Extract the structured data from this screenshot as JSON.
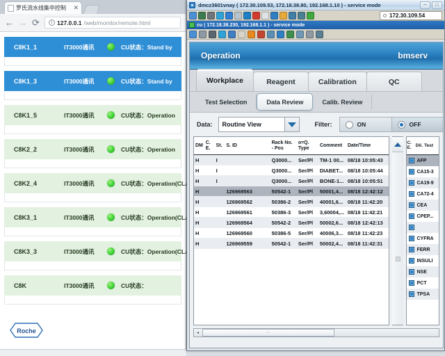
{
  "browser": {
    "tab": {
      "title": "罗氏流水线集中控制",
      "close_label": "✕",
      "favicon": "page-icon"
    },
    "nav": {
      "back": "←",
      "forward": "→",
      "reload": "⟳"
    },
    "omnibox": {
      "info_glyph": "i",
      "host": "127.0.0.1",
      "path": "/web/monitor/remote.html"
    },
    "logo": {
      "text": "Roche"
    }
  },
  "monitor": {
    "rows": [
      {
        "name": "C8K1_1",
        "comm": "IT3000通讯",
        "led": "green",
        "status_label": "CU状态：",
        "status": "Stand by",
        "state": "blue"
      },
      {
        "name": "C8K1_3",
        "comm": "IT3000通讯",
        "led": "green",
        "status_label": "CU状态：",
        "status": "Stand by",
        "state": "blue"
      },
      {
        "name": "C8K1_5",
        "comm": "IT3000通讯",
        "led": "green",
        "status_label": "CU状态：",
        "status": "Operation",
        "state": "green"
      },
      {
        "name": "C8K2_2",
        "comm": "IT3000通讯",
        "led": "green",
        "status_label": "CU状态：",
        "status": "Operation",
        "state": "green"
      },
      {
        "name": "C8K2_4",
        "comm": "IT3000通讯",
        "led": "green",
        "status_label": "CU状态：",
        "status": "Operation(CLAS)",
        "state": "green"
      },
      {
        "name": "C8K3_1",
        "comm": "IT3000通讯",
        "led": "green",
        "status_label": "CU状态：",
        "status": "Operation(CLAS)",
        "state": "green"
      },
      {
        "name": "C8K3_3",
        "comm": "IT3000通讯",
        "led": "green",
        "status_label": "CU状态：",
        "status": "Operation(CLAS)",
        "state": "green"
      },
      {
        "name": "C8K",
        "comm": "IT3000通讯",
        "led": "green",
        "status_label": "CU状态：",
        "status": "",
        "state": "green"
      }
    ]
  },
  "vnc": {
    "window1": {
      "title": "dmcz3601vnay ( 172.30.109.53, 172.18.38.80, 192.168.1.10 ) - service mode",
      "minimize": "─",
      "maximize": "□",
      "address": "172.30.109.54",
      "toolbar_icons": [
        "connect-icon",
        "fullscreen-icon",
        "options-icon",
        "refresh-icon",
        "ctrl-alt-del-icon",
        "send-key-icon",
        "info-icon",
        "stop-icon",
        "transfer-icon",
        "screen-icon",
        "window-icon",
        "scale-icon",
        "settings-icon",
        "chat-icon"
      ]
    },
    "window2": {
      "title": "cu ( 172.18.38.230, 192.168.1.1 ) - service mode",
      "toolbar_icons": [
        "connect-icon",
        "layout-icon",
        "tools-icon",
        "refresh-icon",
        "key-icon",
        "window-icon",
        "alert-icon",
        "network-icon",
        "fullscreen-icon",
        "screen-icon",
        "pointer-icon",
        "upload-icon",
        "frame-icon",
        "chat-icon"
      ]
    }
  },
  "app": {
    "header": {
      "title": "Operation",
      "user": "bmserv"
    },
    "tabs": [
      {
        "label": "Workplace",
        "active": true
      },
      {
        "label": "Reagent",
        "active": false
      },
      {
        "label": "Calibration",
        "active": false
      },
      {
        "label": "QC",
        "active": false
      }
    ],
    "subtabs": [
      {
        "label": "Test Selection",
        "selected": false
      },
      {
        "label": "Data Review",
        "selected": true
      },
      {
        "label": "Calib. Review",
        "selected": false
      }
    ],
    "controls": {
      "data_label": "Data:",
      "data_value": "Routine View",
      "dropdown_icon": "chevron-down-icon",
      "filter_label": "Filter:",
      "filter_on_label": "ON",
      "filter_off_label": "OFF",
      "filter_selected": "OFF"
    },
    "table": {
      "columns": [
        "DM",
        "C. E.",
        "St.",
        "S. ID",
        "Rack No. - Pos",
        "o=Q. Type",
        "Comment",
        "Date/Time"
      ],
      "rows": [
        {
          "dm": "H",
          "ce": "",
          "st": "I",
          "sid": "",
          "rack": "Q3000...",
          "qtype": "Ser/Pl",
          "comment": "TM-1 00...",
          "date": "08/18 10:05:43",
          "selected": false
        },
        {
          "dm": "H",
          "ce": "",
          "st": "I",
          "sid": "",
          "rack": "Q3000...",
          "qtype": "Ser/Pl",
          "comment": "DIABET...",
          "date": "08/18 10:05:44",
          "selected": false
        },
        {
          "dm": "H",
          "ce": "",
          "st": "I",
          "sid": "",
          "rack": "Q3000...",
          "qtype": "Ser/Pl",
          "comment": "BONE-1...",
          "date": "08/18 10:05:51",
          "selected": false
        },
        {
          "dm": "H",
          "ce": "",
          "st": "",
          "sid": "126969563",
          "rack": "50542-1",
          "qtype": "Ser/Pl",
          "comment": "50001,4...",
          "date": "08/18 12:42:12",
          "selected": true
        },
        {
          "dm": "H",
          "ce": "",
          "st": "",
          "sid": "126969562",
          "rack": "50386-2",
          "qtype": "Ser/Pl",
          "comment": "40001,6...",
          "date": "08/18 11:42:20",
          "selected": false
        },
        {
          "dm": "H",
          "ce": "",
          "st": "",
          "sid": "126969561",
          "rack": "50386-3",
          "qtype": "Ser/Pl",
          "comment": "3,60004,...",
          "date": "08/18 11:42:21",
          "selected": false
        },
        {
          "dm": "H",
          "ce": "",
          "st": "",
          "sid": "126969564",
          "rack": "50542-2",
          "qtype": "Ser/Pl",
          "comment": "50002,6...",
          "date": "08/18 12:42:13",
          "selected": false
        },
        {
          "dm": "H",
          "ce": "",
          "st": "",
          "sid": "126969560",
          "rack": "50386-5",
          "qtype": "Ser/Pl",
          "comment": "40006,3...",
          "date": "08/18 11:42:23",
          "selected": false
        },
        {
          "dm": "H",
          "ce": "",
          "st": "",
          "sid": "126969559",
          "rack": "50542-1",
          "qtype": "Ser/Pl",
          "comment": "50002,4...",
          "date": "08/18 11:42:31",
          "selected": false
        }
      ],
      "scroll_up_icon": "chevron-up-icon"
    },
    "testpane": {
      "columns": [
        "C. E.",
        "Dil.",
        "Test"
      ],
      "rows": [
        {
          "test": "AFP",
          "selected": true
        },
        {
          "test": "CA15-3",
          "selected": false
        },
        {
          "test": "CA19-9",
          "selected": false
        },
        {
          "test": "CA72-4",
          "selected": false
        },
        {
          "test": "CEA",
          "selected": false
        },
        {
          "test": "CPEP...",
          "selected": false
        },
        {
          "test": "",
          "selected": false
        },
        {
          "test": "CYFRA",
          "selected": false
        },
        {
          "test": "FERR",
          "selected": false
        },
        {
          "test": "INSULI",
          "selected": false
        },
        {
          "test": "NSE",
          "selected": false
        },
        {
          "test": "PCT",
          "selected": false
        },
        {
          "test": "TPSA",
          "selected": false
        }
      ]
    },
    "hscroll": {
      "left_arrow": "◂",
      "right_arrow": "▸",
      "grip": "⋯"
    }
  },
  "colors": {
    "accent_blue": "#2f86c4",
    "row_blue": "#2e8ed6",
    "row_green": "#e3f1e0",
    "led_green": "#46d63c",
    "selected_row": "#aeb4bd"
  }
}
